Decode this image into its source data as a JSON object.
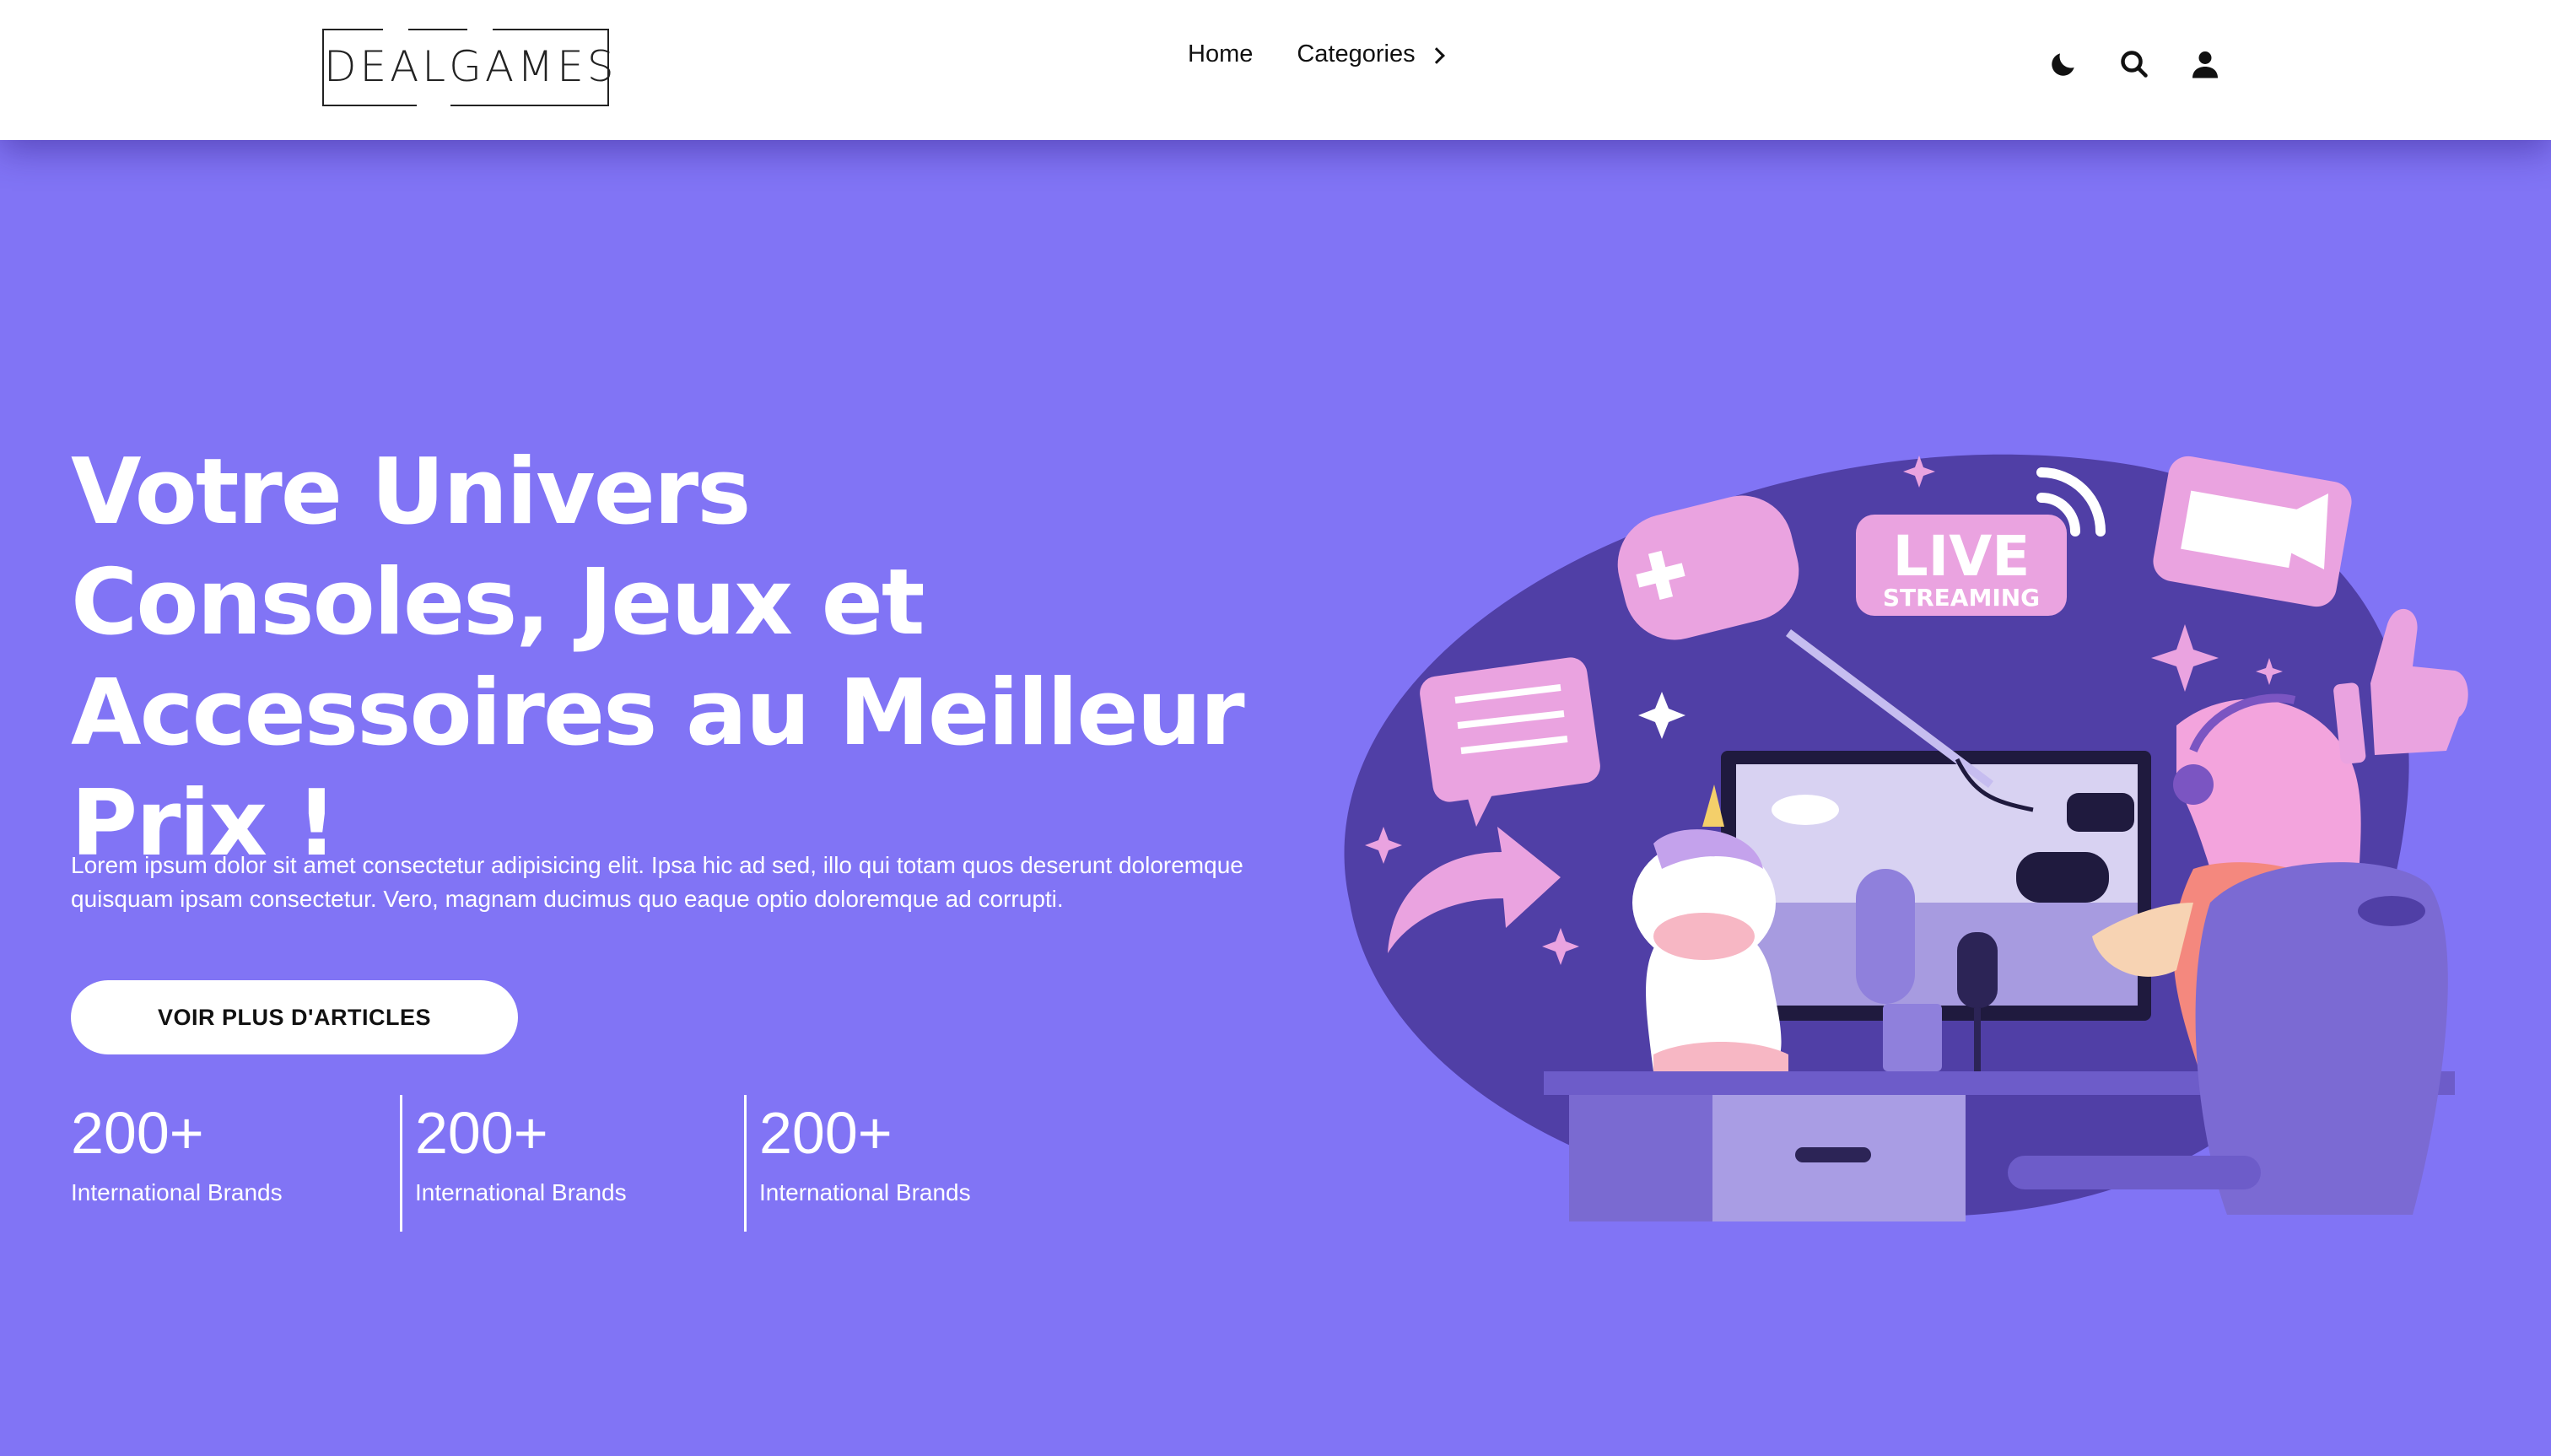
{
  "brand": {
    "logo_text": "DEALGAMES"
  },
  "nav": {
    "items": [
      {
        "label": "Home"
      },
      {
        "label": "Categories"
      }
    ]
  },
  "icons": [
    "moon-icon",
    "search-icon",
    "user-icon"
  ],
  "hero": {
    "title": "Votre Univers Consoles, Jeux et Accessoires au Meilleur Prix !",
    "description": "Lorem ipsum dolor sit amet consectetur adipisicing elit. Ipsa hic ad sed, illo qui totam quos deserunt doloremque quisquam ipsam consectetur. Vero, magnam ducimus quo eaque optio doloremque ad corrupti.",
    "cta_label": "VOIR PLUS D'ARTICLES"
  },
  "stats": [
    {
      "value": "200+",
      "label": "International Brands"
    },
    {
      "value": "200+",
      "label": "International Brands"
    },
    {
      "value": "200+",
      "label": "International Brands"
    }
  ],
  "illustration": {
    "badge_top": "LIVE",
    "badge_bottom": "STREAMING"
  },
  "colors": {
    "background": "#8174f5",
    "header": "#ffffff",
    "text_light": "#ffffff",
    "accent_pink": "#eaa3e0",
    "blob_purple": "#503fa6"
  }
}
